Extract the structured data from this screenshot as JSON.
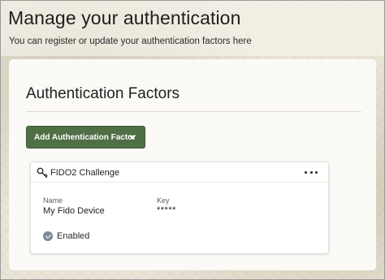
{
  "page": {
    "title": "Manage your authentication",
    "subtitle": "You can register or update your authentication factors here"
  },
  "panel": {
    "title": "Authentication Factors",
    "add_button_label": "Add Authentication Factor"
  },
  "factors": [
    {
      "icon": "key-icon",
      "title": "FIDO2 Challenge",
      "name_label": "Name",
      "name_value": "My Fido Device",
      "key_label": "Key",
      "key_value": "*****",
      "status": "Enabled",
      "status_icon": "check-circle-icon"
    }
  ],
  "colors": {
    "accent_button": "#4f6f45",
    "background": "#e9e4d6",
    "panel": "#fbfaf7",
    "status_icon": "#7e8b96"
  }
}
